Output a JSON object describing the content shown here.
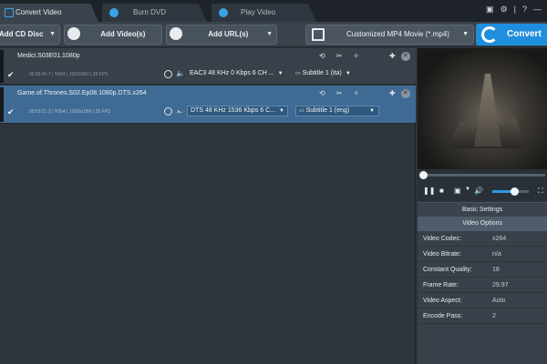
{
  "tabs": [
    {
      "label": "Convert Video"
    },
    {
      "label": "Burn DVD"
    },
    {
      "label": "Play Video"
    }
  ],
  "window_buttons": [
    "▤",
    "⚙",
    "—",
    "?",
    "—"
  ],
  "toolbar": {
    "add_cd_disc": "Add CD Disc",
    "add_videos": "Add Video(s)",
    "add_urls": "Add URL(s)",
    "format": "Customized MP4 Movie (*.mp4)",
    "convert": "Convert"
  },
  "files": [
    {
      "name": "Medici.S03E01.1080p",
      "meta": "00:56:45.7   |   H264  |  1920x960  |  25 FPS",
      "audio": "EAC3 48 KHz 0 Kbps 6 CH ...",
      "subtitle": "Subtitle 1 (ita)",
      "selected": false
    },
    {
      "name": "Game.of.Thrones.S02.Ep08.1080p.DTS.x264",
      "meta": "00:53:21.2   |   H264  |  1920x1080  |  25 FPS",
      "audio": "DTS 48 KHz 1536 Kbps 6 C...",
      "subtitle": "Subtitle 1 (eng)",
      "selected": true
    }
  ],
  "settings": {
    "basic_label": "Basic Settings",
    "video_label": "Video Options",
    "rows": [
      {
        "key": "Video Codec:",
        "value": "x264"
      },
      {
        "key": "Video Bitrate:",
        "value": "n/a"
      },
      {
        "key": "Constant Quality:",
        "value": "18"
      },
      {
        "key": "Frame Rate:",
        "value": "29.97"
      },
      {
        "key": "Video Aspect:",
        "value": "Auto"
      },
      {
        "key": "Encode Pass:",
        "value": "2"
      }
    ]
  },
  "player": {
    "volume_fraction": 0.6,
    "seek_fraction": 0.0
  },
  "colors": {
    "accent": "#1f8fdd",
    "selected_row": "#3f6a93"
  }
}
